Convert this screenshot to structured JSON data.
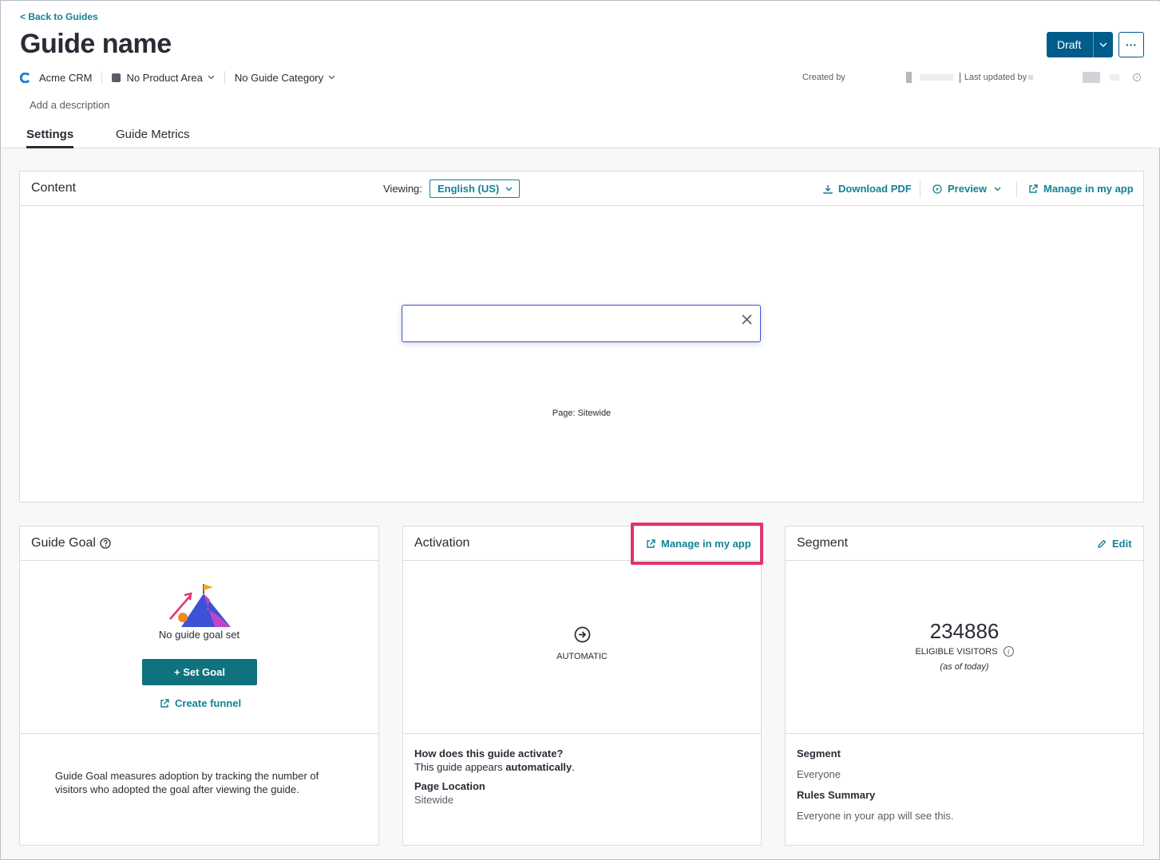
{
  "header": {
    "back_link": "< Back to Guides",
    "title": "Guide name",
    "status_label": "Draft",
    "more_label": "···",
    "app_name": "Acme CRM",
    "product_area": "No Product Area",
    "guide_category": "No Guide Category",
    "created_by_label": "Created by",
    "last_updated_label": "Last updated by",
    "add_description": "Add a description"
  },
  "tabs": [
    {
      "label": "Settings",
      "active": true
    },
    {
      "label": "Guide Metrics",
      "active": false
    }
  ],
  "content_card": {
    "title": "Content",
    "viewing_label": "Viewing:",
    "language": "English (US)",
    "download_pdf": "Download PDF",
    "preview": "Preview",
    "manage_in_app": "Manage in my app",
    "page_label": "Page: Sitewide"
  },
  "goal_card": {
    "title": "Guide Goal",
    "empty_text": "No guide goal set",
    "set_goal": "+ Set Goal",
    "create_funnel": "Create funnel",
    "description": "Guide Goal measures adoption by tracking the number of visitors who adopted the goal after viewing the guide."
  },
  "activation_card": {
    "title": "Activation",
    "manage_in_app": "Manage in my app",
    "mode": "AUTOMATIC",
    "question": "How does this guide activate?",
    "answer_prefix": "This guide appears ",
    "answer_bold": "automatically",
    "answer_suffix": ".",
    "location_label": "Page Location",
    "location_value": "Sitewide"
  },
  "segment_card": {
    "title": "Segment",
    "edit": "Edit",
    "count": "234886",
    "count_label": "ELIGIBLE VISITORS",
    "count_note": "(as of today)",
    "segment_label": "Segment",
    "segment_value": "Everyone",
    "rules_label": "Rules Summary",
    "rules_value": "Everyone in your app will see this."
  },
  "colors": {
    "accent": "#128297",
    "primary_button": "#11727f",
    "status_button": "#005c8a",
    "highlight": "#e0356c",
    "modal_border": "#3d52d5"
  }
}
